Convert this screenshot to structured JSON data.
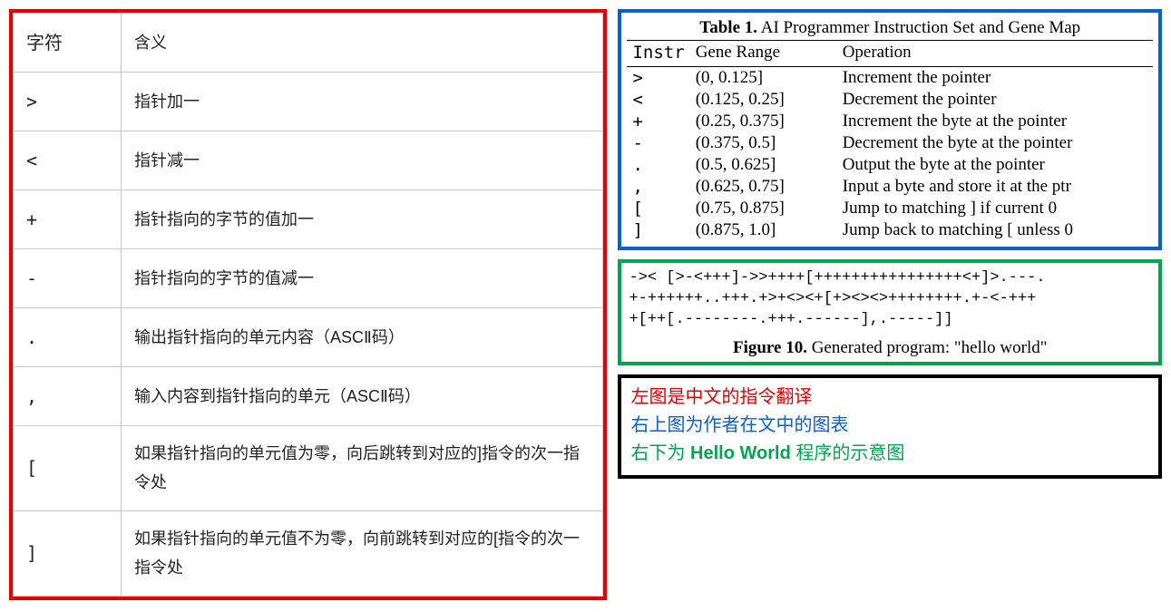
{
  "left_table": {
    "header_symbol": "字符",
    "header_meaning": "含义",
    "rows": [
      {
        "sym": ">",
        "meaning": "指针加一"
      },
      {
        "sym": "<",
        "meaning": "指针减一"
      },
      {
        "sym": "+",
        "meaning": "指针指向的字节的值加一"
      },
      {
        "sym": "-",
        "meaning": "指针指向的字节的值减一"
      },
      {
        "sym": ".",
        "meaning": "输出指针指向的单元内容（ASCⅡ码）"
      },
      {
        "sym": ",",
        "meaning": "输入内容到指针指向的单元（ASCⅡ码）"
      },
      {
        "sym": "[",
        "meaning": "如果指针指向的单元值为零，向后跳转到对应的]指令的次一指令处"
      },
      {
        "sym": "]",
        "meaning": "如果指针指向的单元值不为零，向前跳转到对应的[指令的次一指令处"
      }
    ]
  },
  "blue_table": {
    "caption_bold": "Table 1.",
    "caption_rest": "  AI Programmer Instruction Set and Gene Map",
    "header_instr": "Instr",
    "header_range": "Gene Range",
    "header_op": "Operation",
    "rows": [
      {
        "instr": ">",
        "range": "(0, 0.125]",
        "op": "Increment the pointer"
      },
      {
        "instr": "<",
        "range": "(0.125, 0.25]",
        "op": "Decrement the pointer"
      },
      {
        "instr": "+",
        "range": "(0.25, 0.375]",
        "op": "Increment the byte at the pointer"
      },
      {
        "instr": "-",
        "range": "(0.375, 0.5]",
        "op": "Decrement the byte at the pointer"
      },
      {
        "instr": ".",
        "range": "(0.5, 0.625]",
        "op": "Output the byte at the pointer"
      },
      {
        "instr": ",",
        "range": "(0.625, 0.75]",
        "op": "Input a byte and store it at the ptr"
      },
      {
        "instr": "[",
        "range": "(0.75, 0.875]",
        "op": "Jump to matching ] if current 0"
      },
      {
        "instr": "]",
        "range": "(0.875, 1.0]",
        "op": "Jump back to matching [ unless 0"
      }
    ]
  },
  "green_box": {
    "code": "->< [>-<+++]->>++++[++++++++++++++++<+]>.---.\n+-++++++..+++.+>+<><+[+><><>++++++++.+-<-+++\n+[++[.--------.+++.------],.-----]]",
    "fig_bold": "Figure 10.",
    "fig_rest": "  Generated program: \"hello world\""
  },
  "legend": {
    "line_red": "左图是中文的指令翻译",
    "line_blue": "右上图为作者在文中的图表",
    "line_green_pre": "右下为 ",
    "line_green_hw": "Hello World",
    "line_green_post": " 程序的示意图"
  }
}
